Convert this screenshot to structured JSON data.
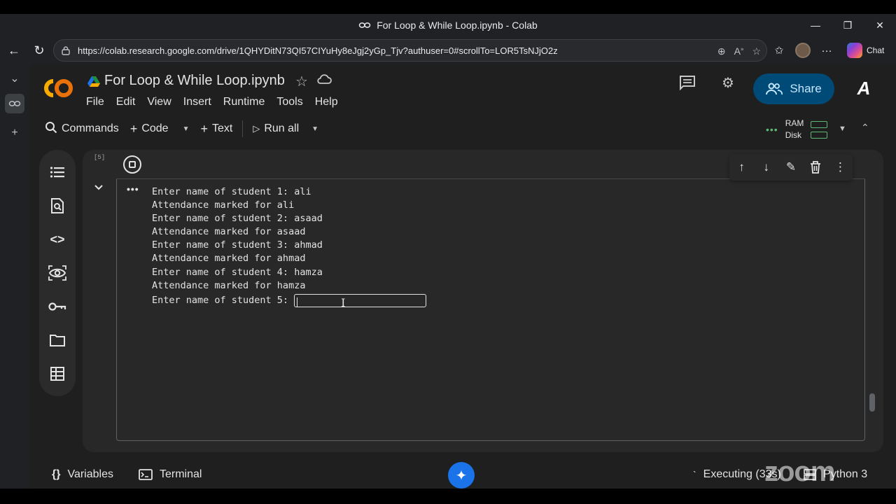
{
  "window": {
    "title": "For Loop & While Loop.ipynb - Colab",
    "minimize": "—",
    "restore": "❐",
    "close": "✕"
  },
  "browser": {
    "url": "https://colab.research.google.com/drive/1QHYDitN73QI57CIYuHy8eJgj2yGp_Tjv?authuser=0#scrollTo=LOR5TsNJjO2z",
    "chat_label": "Chat"
  },
  "notebook": {
    "title": "For Loop & While Loop.ipynb",
    "menu": [
      "File",
      "Edit",
      "View",
      "Insert",
      "Runtime",
      "Tools",
      "Help"
    ],
    "share_label": "Share",
    "profile_letter": "A"
  },
  "toolbar": {
    "commands": "Commands",
    "code": "Code",
    "text": "Text",
    "run_all": "Run all",
    "ram": "RAM",
    "disk": "Disk"
  },
  "cell": {
    "execution_count": "[5]",
    "output_lines": [
      "Enter name of student 1: ali",
      "Attendance marked for ali",
      "Enter name of student 2: asaad",
      "Attendance marked for asaad",
      "Enter name of student 3: ahmad",
      "Attendance marked for ahmad",
      "Enter name of student 4: hamza",
      "Attendance marked for hamza"
    ],
    "prompt": "Enter name of student 5:",
    "input_value": ""
  },
  "status": {
    "variables": "Variables",
    "terminal": "Terminal",
    "executing": "Executing (33s)",
    "kernel": "Python 3",
    "watermark": "zoom"
  },
  "colors": {
    "accent_blue": "#004a77",
    "colab_orange": "#f9ab00",
    "resource_green": "#5bb974"
  }
}
